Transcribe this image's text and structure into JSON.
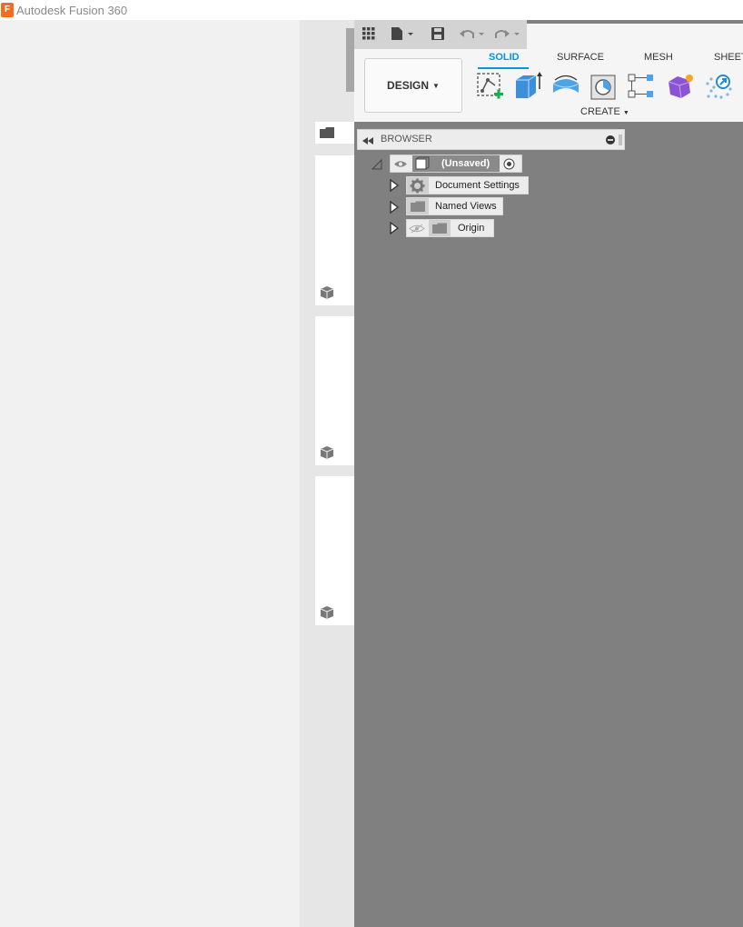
{
  "window": {
    "title": "Autodesk Fusion 360",
    "app_icon": "F"
  },
  "workspace": {
    "label": "DESIGN"
  },
  "ribbon": {
    "tabs": [
      {
        "label": "SOLID",
        "active": true
      },
      {
        "label": "SURFACE",
        "active": false
      },
      {
        "label": "MESH",
        "active": false
      },
      {
        "label": "SHEET",
        "active": false
      }
    ],
    "group_label": "CREATE"
  },
  "browser": {
    "title": "BROWSER",
    "root": {
      "label": "(Unsaved)"
    },
    "nodes": [
      {
        "label": "Document Settings",
        "icon": "gear-icon"
      },
      {
        "label": "Named Views",
        "icon": "folder-icon"
      },
      {
        "label": "Origin",
        "icon": "folder-icon",
        "hidden": true
      }
    ]
  },
  "colors": {
    "accent": "#0696d7",
    "canvas": "#808080",
    "app_icon": "#f26c22"
  }
}
